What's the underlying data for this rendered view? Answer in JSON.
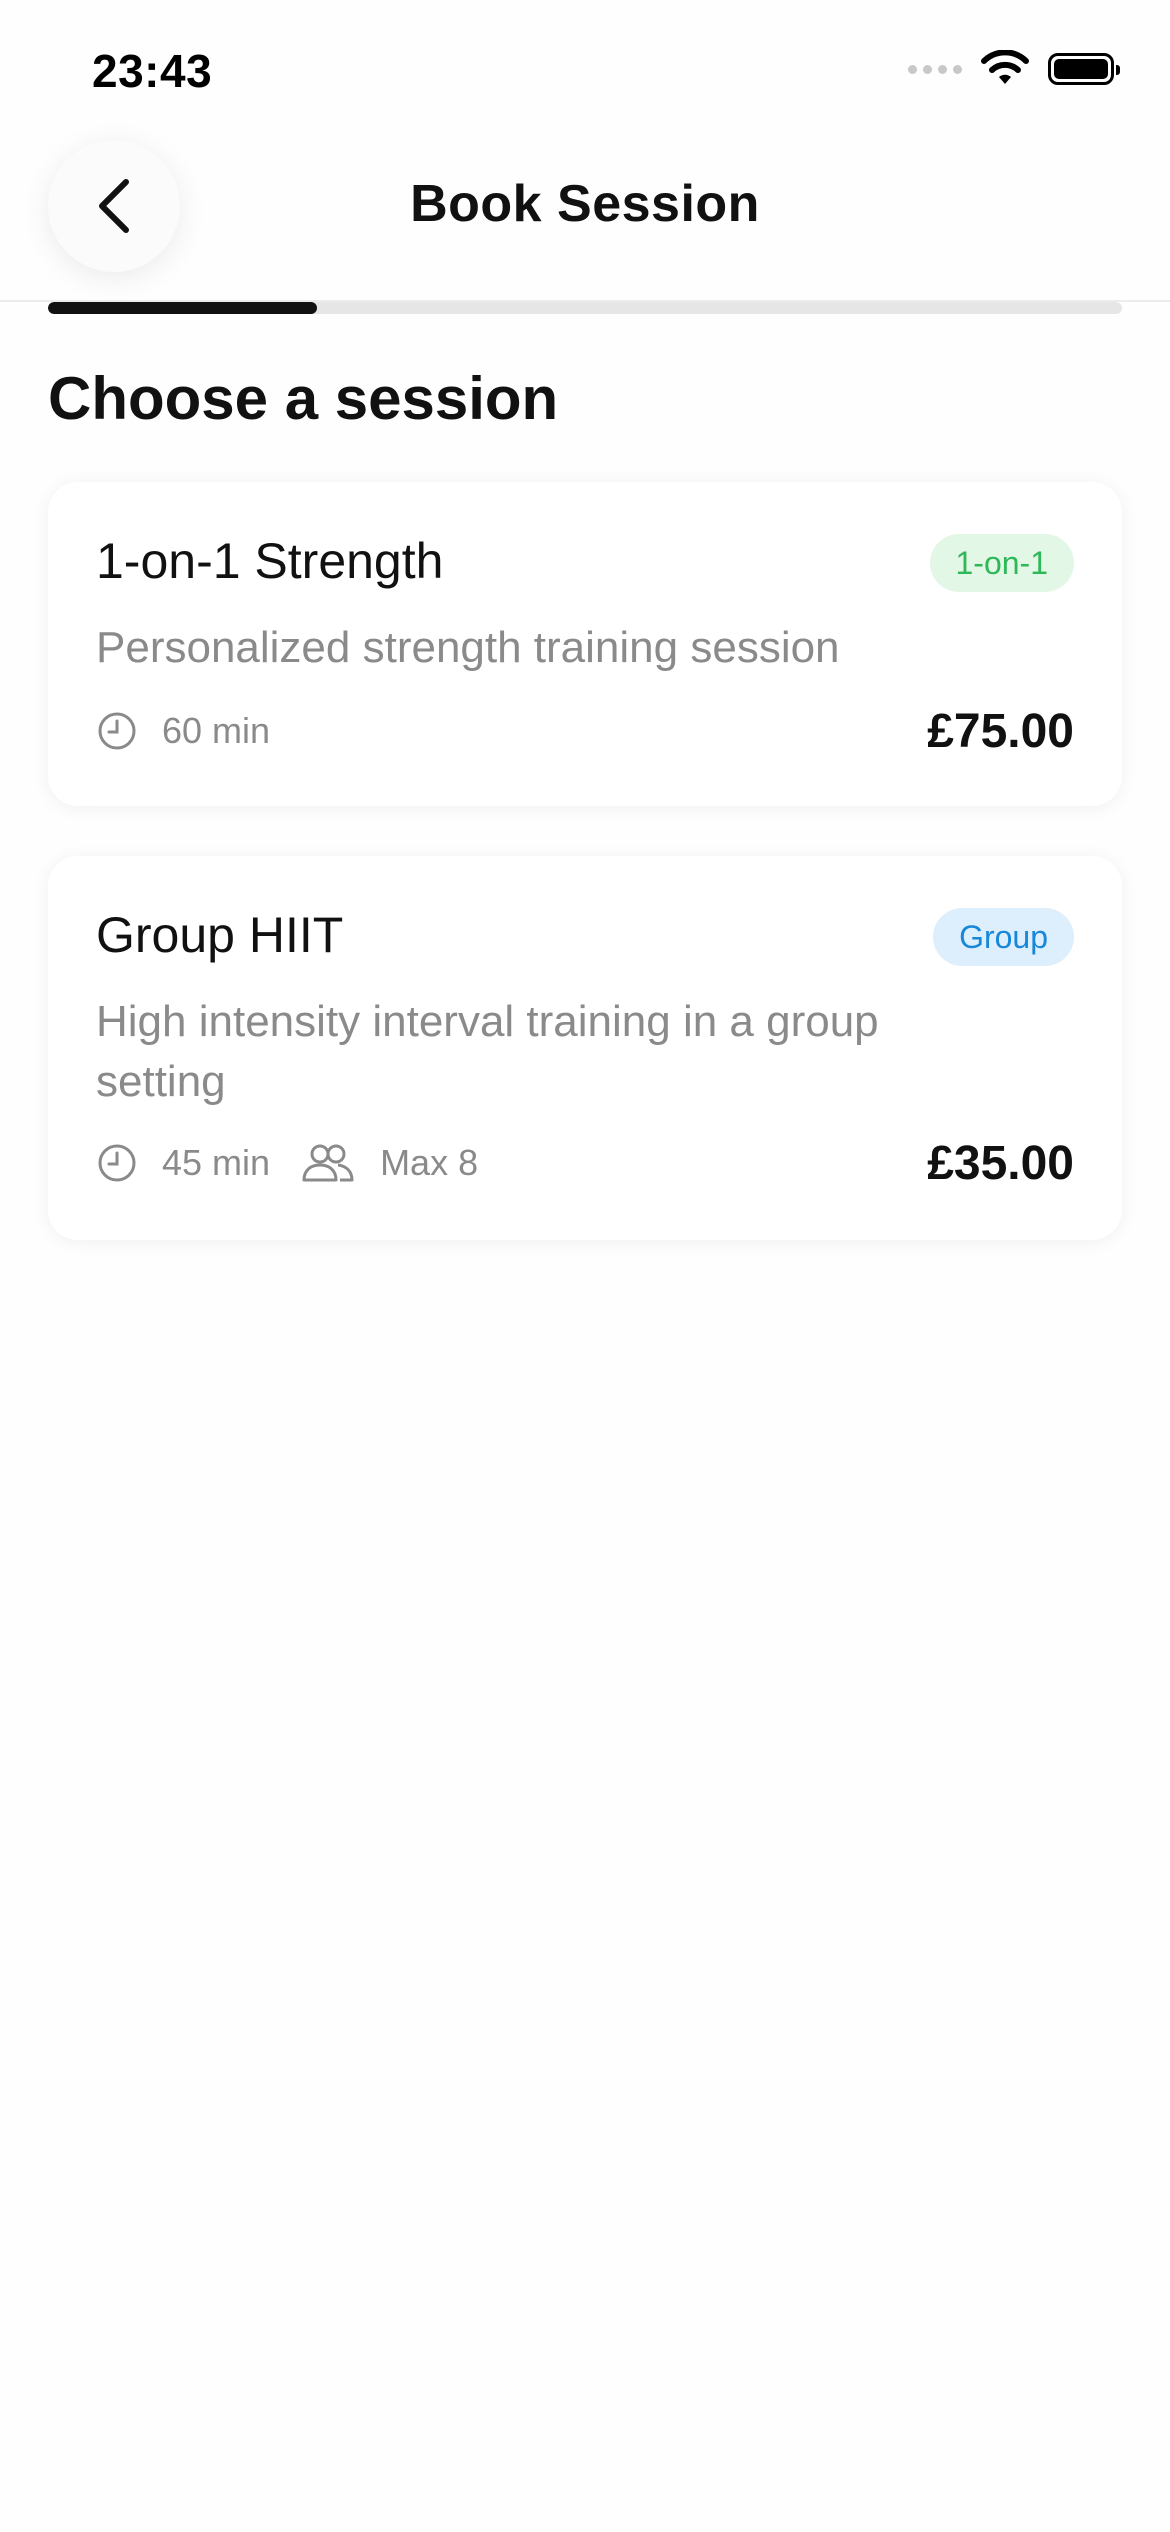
{
  "status_bar": {
    "time": "23:43"
  },
  "header": {
    "title": "Book Session",
    "back_icon": "chevron-left-icon"
  },
  "progress": {
    "fraction": 0.25
  },
  "section": {
    "heading": "Choose a session"
  },
  "sessions": [
    {
      "title": "1-on-1 Strength",
      "badge": "1-on-1",
      "badge_color": "#2fb857",
      "description": "Personalized strength training session",
      "duration": "60 min",
      "price": "£75.00"
    },
    {
      "title": "Group HIIT",
      "badge": "Group",
      "badge_color": "#1787d9",
      "description": "High intensity interval training in a group setting",
      "duration": "45 min",
      "capacity": "Max 8",
      "price": "£35.00"
    }
  ]
}
